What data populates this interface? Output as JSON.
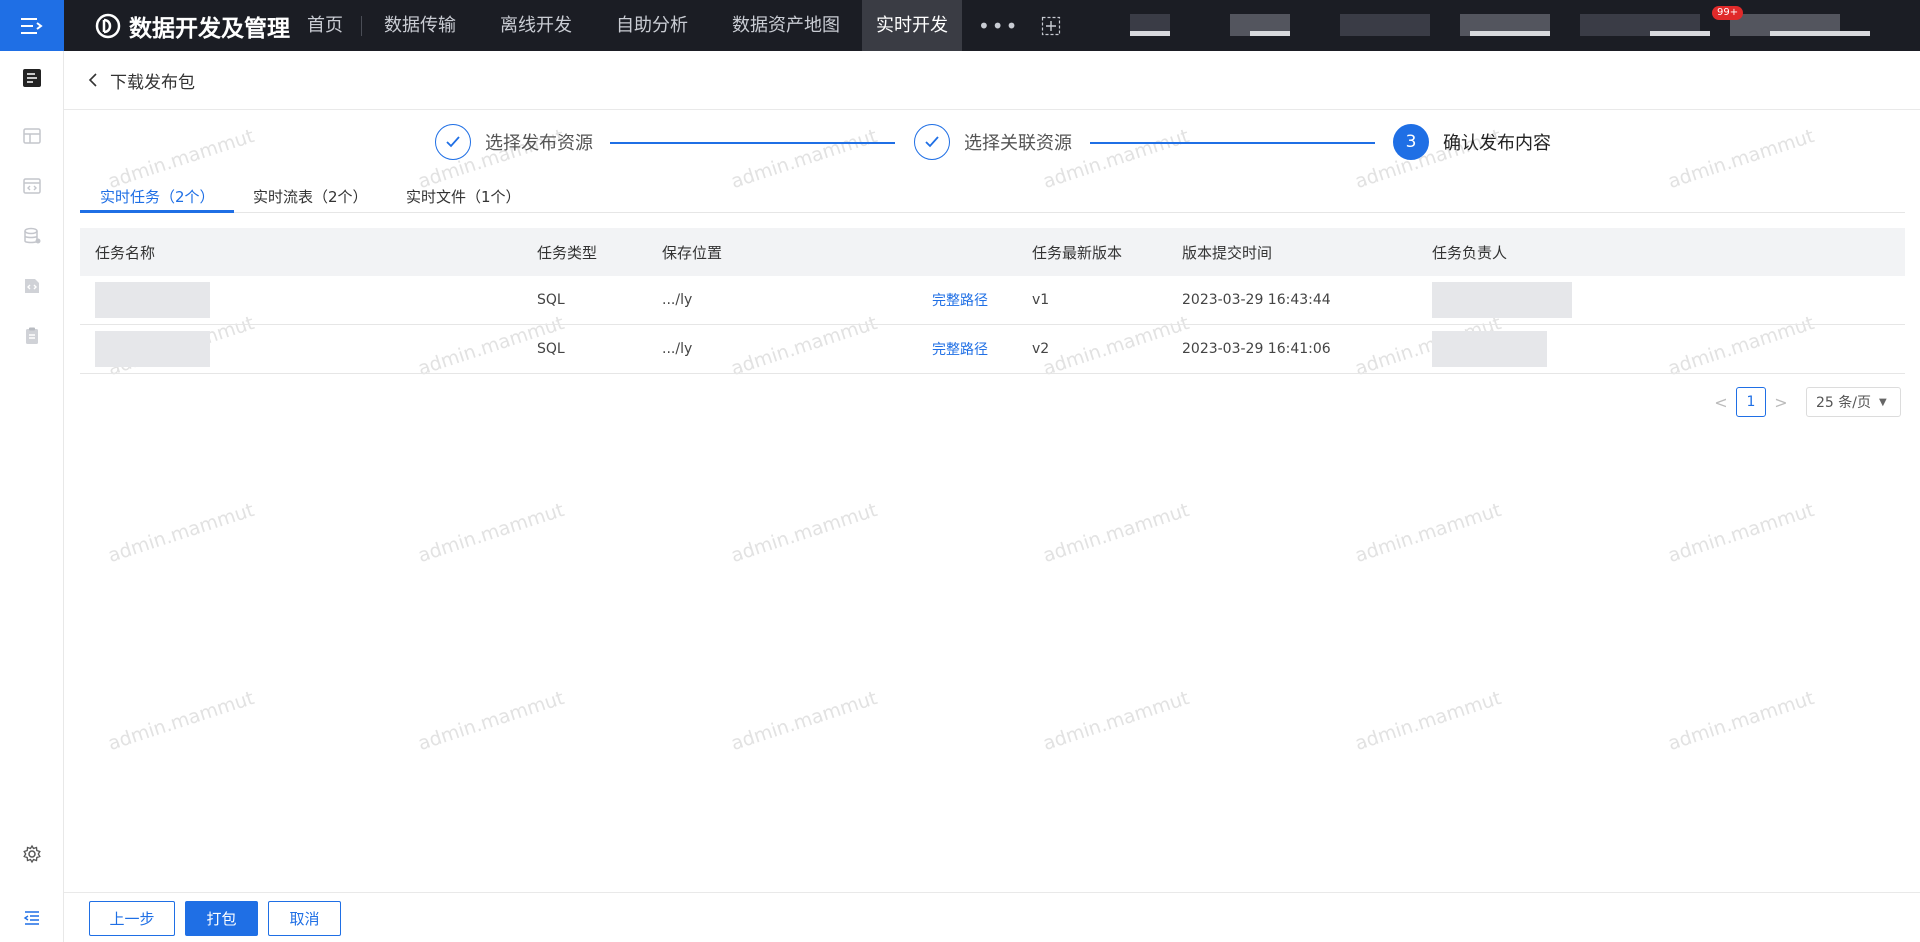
{
  "topbar": {
    "brand_title": "数据开发及管理",
    "nav": [
      "首页",
      "数据传输",
      "离线开发",
      "自助分析",
      "数据资产地图",
      "实时开发"
    ],
    "active_nav": "实时开发",
    "more_label": "•••",
    "badge": "99+"
  },
  "header": {
    "title": "下载发布包"
  },
  "steps": [
    {
      "label": "选择发布资源",
      "state": "done"
    },
    {
      "label": "选择关联资源",
      "state": "done"
    },
    {
      "number": "3",
      "label": "确认发布内容",
      "state": "current"
    }
  ],
  "tabs": [
    "实时任务（2个）",
    "实时流表（2个）",
    "实时文件（1个）"
  ],
  "table": {
    "columns": [
      "任务名称",
      "任务类型",
      "保存位置",
      "任务最新版本",
      "版本提交时间",
      "任务负责人"
    ],
    "rows": [
      {
        "name": "",
        "type": "SQL",
        "path": ".../ly",
        "path_link": "完整路径",
        "version": "v1",
        "time": "2023-03-29 16:43:44",
        "owner": ""
      },
      {
        "name": "",
        "type": "SQL",
        "path": ".../ly",
        "path_link": "完整路径",
        "version": "v2",
        "time": "2023-03-29 16:41:06",
        "owner": ""
      }
    ]
  },
  "pagination": {
    "prev": "<",
    "current": "1",
    "next": ">",
    "page_size": "25 条/页"
  },
  "watermark": "admin.mammut",
  "footer": {
    "prev_label": "上一步",
    "pack_label": "打包",
    "cancel_label": "取消"
  },
  "colors": {
    "accent": "#1f6fe5",
    "topbar": "#1b1d24"
  }
}
